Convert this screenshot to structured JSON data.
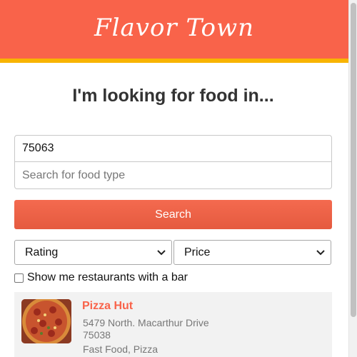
{
  "header": {
    "brand": "Flavor Town"
  },
  "main": {
    "headline": "I'm looking for food in...",
    "location_value": "75063",
    "food_placeholder": "Search for food type",
    "search_label": "Search",
    "sort_select": "Rating",
    "price_select": "Price",
    "bar_checkbox_label": "Show me restaurants with a bar"
  },
  "results": [
    {
      "name": "Pizza Hut",
      "address_line1": "5479 North. Macarthur Drive",
      "address_line2": "75038",
      "categories": "Fast Food, Pizza"
    }
  ],
  "colors": {
    "accent": "#f9634a",
    "stripe": "#f8b400"
  }
}
